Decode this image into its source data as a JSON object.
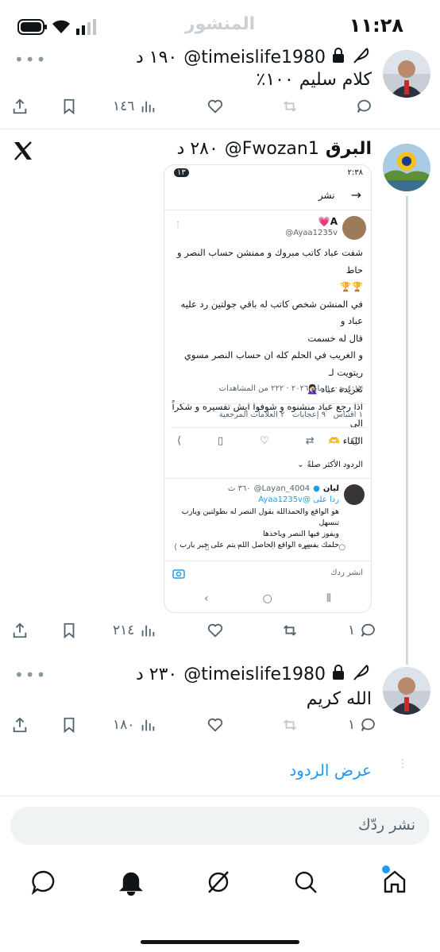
{
  "status_bar": {
    "time": "١١:٢٨"
  },
  "header": {
    "title": "المنشور"
  },
  "tweet1": {
    "handle": "@timeislife1980",
    "time": "١٩٠ د",
    "text": "كلام سليم ١٠٠٪",
    "stats": {
      "replies": "",
      "retweets": "",
      "views": "١٤٦"
    }
  },
  "tweet2": {
    "name": "البرق",
    "handle": "@Fwozan1",
    "time": "٢٨٠ د",
    "stats": {
      "replies": "١",
      "retweets": "",
      "views": "٢١٤"
    },
    "embed": {
      "status_time": "٢:٣٨",
      "status_badge": "١٣",
      "header_title": "نشر",
      "author_name": "A💗",
      "author_handle": "@Ayaa1235v",
      "lines": [
        "شفت عباد كاتب مبروك و ممنشن حساب النصر و حاط",
        "🏆🏆",
        "في المنشن شخص كاتب له باقي جولتين رد عليه عباد و",
        "قال له خسمت",
        "و الغريب في الحلم كله ان حساب النصر مسوي ريتويت لـ",
        "تغريدة عباد 🤦🏻‍♀️",
        "اذا رجع عباد منشنوه و شوفوا ايش تفسيره و شكراً الى",
        "اللقاء 🫶"
      ],
      "meta": "٤:١٢ م ·١٠ مايو ٢٠٢٦ · ٢٢٢ من المشاهدات",
      "stats_line": "١ اقتباس   ٩ إعجابات   ٢ العلامات المرجعية",
      "replies_label": "الردود الأكثر صلةً",
      "reply": {
        "name": "ليان",
        "handle": "@Layan_4004",
        "time": "٣٦٠ ث",
        "replying_to": "ردا على @Ayaa1235v",
        "lines": [
          "هو الواقع والحمدالله يقول النصر له بطولتين ويارب تنسهل",
          "ويفوز فيها النصر وياخذها",
          "حلمك يفسره الواقع الحاصل الله يتم على خير يارب"
        ],
        "stat": "٢"
      },
      "reply_placeholder": "انشر ردك"
    }
  },
  "tweet3": {
    "handle": "@timeislife1980",
    "time": "٢٣٠ د",
    "text": "الله كريم",
    "stats": {
      "replies": "١",
      "retweets": "",
      "views": "١٨٠"
    }
  },
  "show_replies": "عرض الردود",
  "reply_box": {
    "placeholder": "نشر ردّك"
  },
  "colors": {
    "link": "#1d9bf0",
    "verified": "#1d9bf0",
    "notification_dot": "#1d9bf0"
  }
}
